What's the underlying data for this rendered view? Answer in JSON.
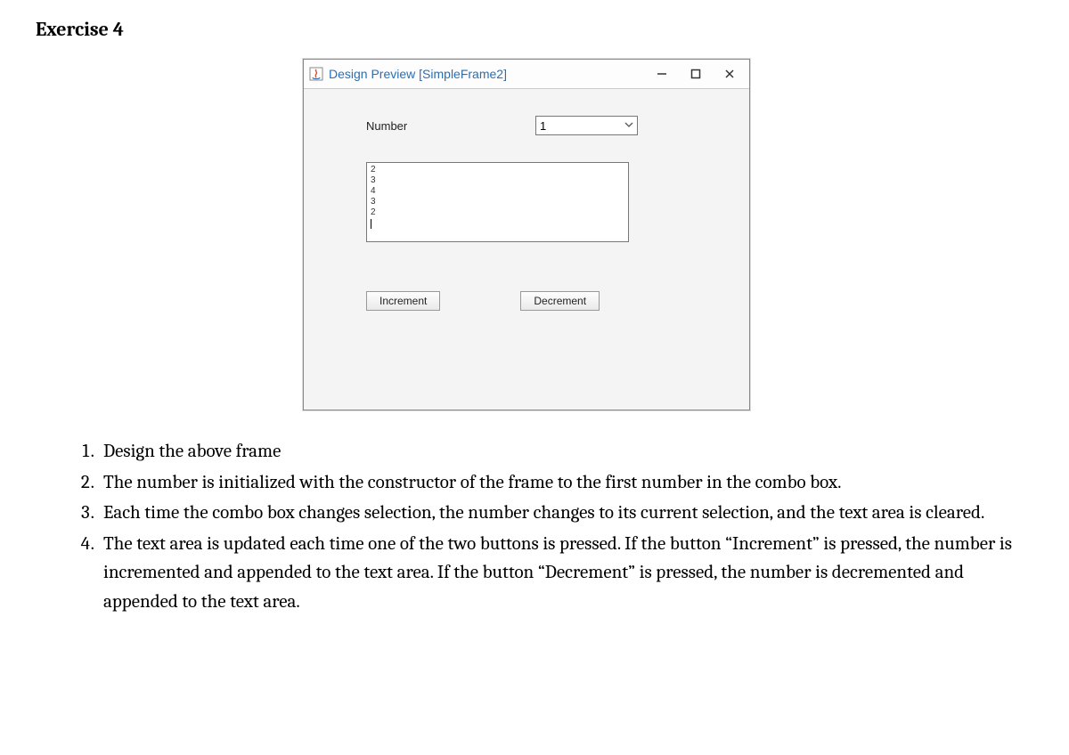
{
  "heading": "Exercise 4",
  "window": {
    "title": "Design Preview [SimpleFrame2]",
    "number_label": "Number",
    "combo_value": "1",
    "textarea_lines": [
      "2",
      "3",
      "4",
      "3",
      "2"
    ],
    "increment_label": "Increment",
    "decrement_label": "Decrement"
  },
  "instructions": [
    "Design the above frame",
    "The number is initialized with the constructor of the frame to the first number in the combo box.",
    "Each time the combo box changes selection, the number changes to its current selection, and the text area is cleared.",
    "The text area is updated each time one of the two buttons is pressed. If the button “Increment” is pressed, the number is incremented and appended to the text area. If the button “Decrement” is pressed, the number is decremented and appended to the text area."
  ]
}
